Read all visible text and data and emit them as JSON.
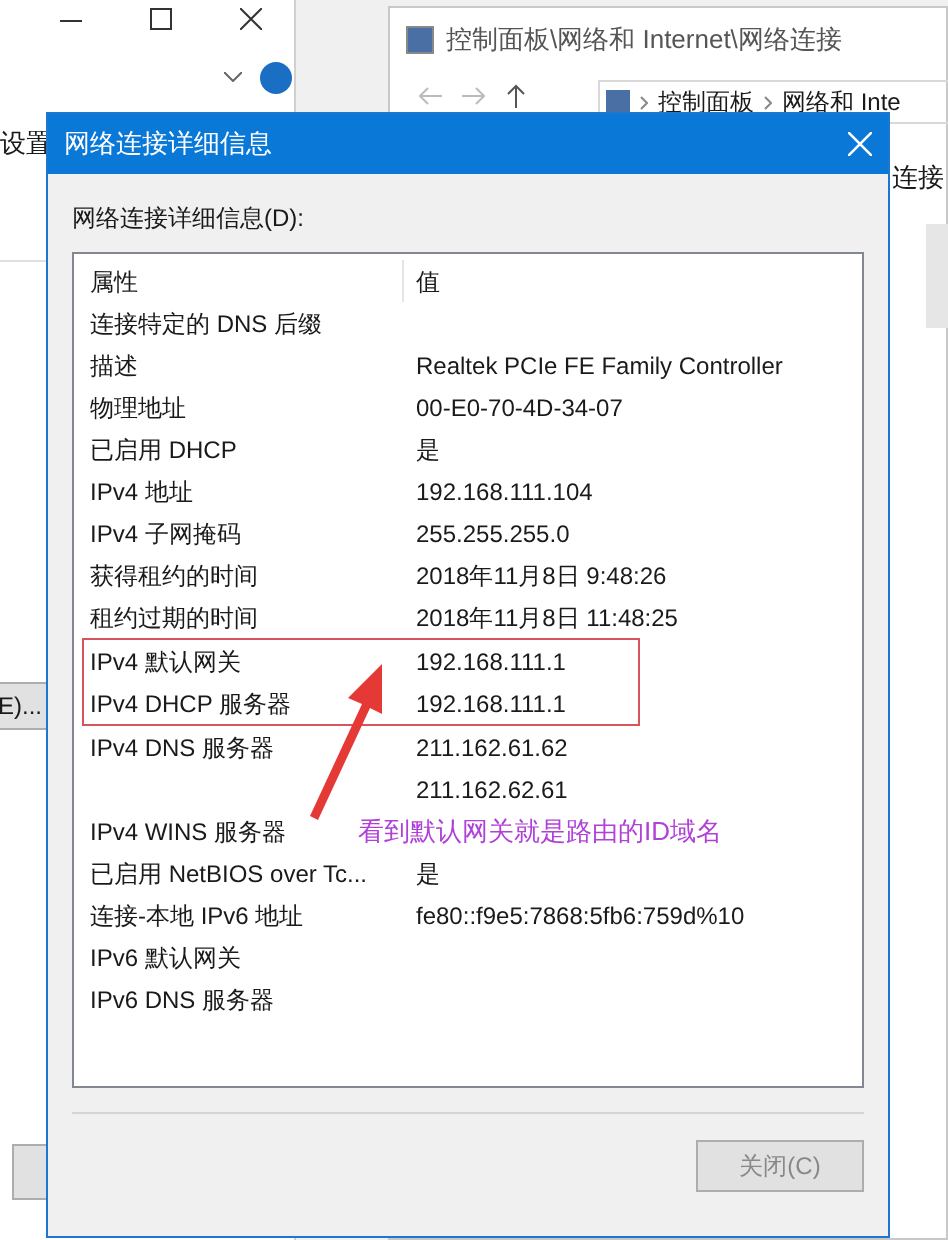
{
  "background_left": {
    "menu_text": "设置",
    "button_label": "E)..."
  },
  "background_explorer": {
    "title": "控制面板\\网络和 Internet\\网络连接",
    "breadcrumb": [
      "控制面板",
      "网络和 Inte"
    ],
    "side_text": "连接"
  },
  "dialog": {
    "title": "网络连接详细信息",
    "label": "网络连接详细信息(D):",
    "columns": [
      "属性",
      "值"
    ],
    "rows": [
      {
        "property": "连接特定的 DNS 后缀",
        "highlighted": false
      },
      {
        "property": "描述",
        "value": "Realtek PCIe FE Family Controller",
        "highlighted": false
      },
      {
        "property": "物理地址",
        "value": "00-E0-70-4D-34-07",
        "highlighted": false
      },
      {
        "property": "已启用 DHCP",
        "value": "是",
        "highlighted": false
      },
      {
        "property": "IPv4 地址",
        "value": "192.168.111.104",
        "highlighted": false
      },
      {
        "property": "IPv4 子网掩码",
        "value": "255.255.255.0",
        "highlighted": false
      },
      {
        "property": "获得租约的时间",
        "value": "2018年11月8日 9:48:26",
        "highlighted": false
      },
      {
        "property": "租约过期的时间",
        "value": "2018年11月8日 11:48:25",
        "highlighted": false
      },
      {
        "property": "IPv4 默认网关",
        "value": "192.168.111.1",
        "highlighted": true
      },
      {
        "property": "IPv4 DHCP 服务器",
        "value": "192.168.111.1",
        "highlighted": true
      },
      {
        "property": "IPv4 DNS 服务器",
        "value": "211.162.61.62",
        "highlighted": false
      },
      {
        "value": "211.162.62.61",
        "highlighted": false
      },
      {
        "property": "IPv4 WINS 服务器",
        "highlighted": false
      },
      {
        "property": "已启用 NetBIOS over Tc...",
        "value": "是",
        "highlighted": false
      },
      {
        "property": "连接-本地 IPv6 地址",
        "value": "fe80::f9e5:7868:5fb6:759d%10",
        "highlighted": false
      },
      {
        "property": "IPv6 默认网关",
        "highlighted": false
      },
      {
        "property": "IPv6 DNS 服务器",
        "highlighted": false
      }
    ],
    "close_button": "关闭(C)"
  },
  "annotation": {
    "text": "看到默认网关就是路由的ID域名"
  }
}
